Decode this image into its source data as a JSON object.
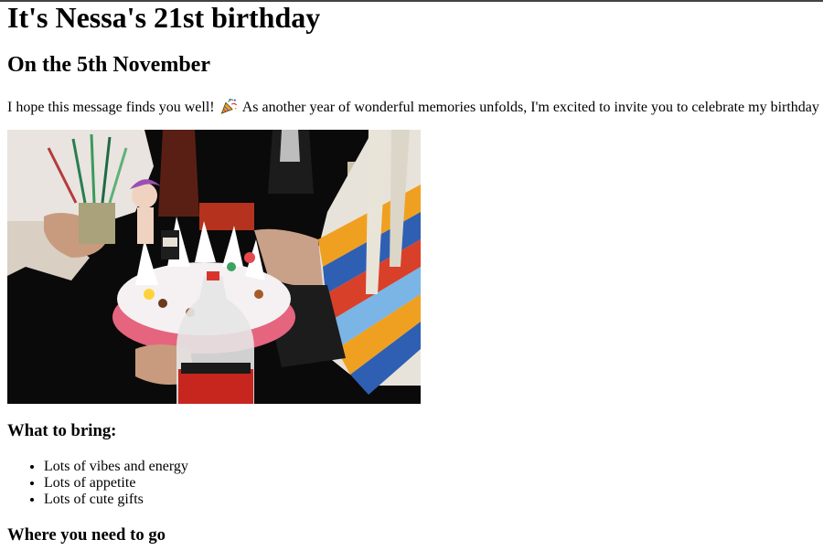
{
  "page": {
    "title": "It's Nessa's 21st birthday",
    "subtitle": "On the 5th November",
    "intro_before_emoji": "I hope this message finds you well! ",
    "intro_emoji_icon": "party-popper-icon",
    "intro_after_emoji": " As another year of wonderful memories unfolds, I'm excited to invite you to celebrate my birthday",
    "photo_icon": "birthday-cake-photo"
  },
  "bring": {
    "heading": "What to bring:",
    "items": [
      "Lots of vibes and energy",
      "Lots of appetite",
      "Lots of cute gifts"
    ]
  },
  "where": {
    "heading": "Where you need to go"
  }
}
